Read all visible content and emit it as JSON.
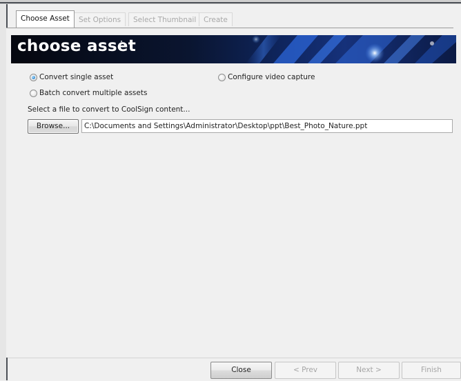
{
  "tabs": [
    {
      "label": "Choose Asset",
      "active": true
    },
    {
      "label": "Set Options",
      "active": false
    },
    {
      "label": "Select Thumbnail",
      "active": false
    },
    {
      "label": "Create",
      "active": false
    }
  ],
  "banner": {
    "title": "choose asset"
  },
  "options": {
    "convert_single": {
      "label": "Convert single asset",
      "checked": true
    },
    "batch_convert": {
      "label": "Batch convert multiple assets",
      "checked": false
    },
    "configure_video": {
      "label": "Configure video capture",
      "checked": false
    }
  },
  "file": {
    "prompt": "Select a file to convert to CoolSign content...",
    "browse_label": "Browse...",
    "path_value": "C:\\Documents and Settings\\Administrator\\Desktop\\ppt\\Best_Photo_Nature.ppt"
  },
  "footer": {
    "close_label": "Close",
    "prev_label": "< Prev",
    "next_label": "Next >",
    "finish_label": "Finish"
  },
  "colors": {
    "accent_radio": "#3d94d8",
    "banner_dark": "#05070f",
    "banner_blue": "#16317a"
  }
}
